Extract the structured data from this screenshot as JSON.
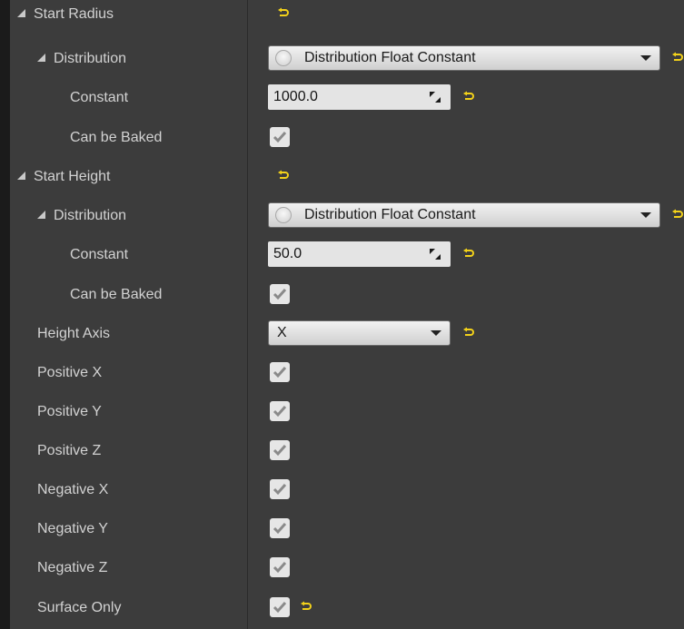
{
  "colors": {
    "panel_bg": "#3c3c3c",
    "reset_icon": "#f2d11a",
    "check_mark": "#8a8a8a"
  },
  "rows": {
    "start_radius": {
      "label": "Start Radius"
    },
    "start_radius_distribution": {
      "label": "Distribution",
      "value": "Distribution Float Constant"
    },
    "start_radius_constant": {
      "label": "Constant",
      "value": "1000.0"
    },
    "start_radius_can_be_baked": {
      "label": "Can be Baked",
      "checked": true
    },
    "start_height": {
      "label": "Start Height"
    },
    "start_height_distribution": {
      "label": "Distribution",
      "value": "Distribution Float Constant"
    },
    "start_height_constant": {
      "label": "Constant",
      "value": "50.0"
    },
    "start_height_can_be_baked": {
      "label": "Can be Baked",
      "checked": true
    },
    "height_axis": {
      "label": "Height Axis",
      "value": "X"
    },
    "positive_x": {
      "label": "Positive X",
      "checked": true
    },
    "positive_y": {
      "label": "Positive Y",
      "checked": true
    },
    "positive_z": {
      "label": "Positive Z",
      "checked": true
    },
    "negative_x": {
      "label": "Negative X",
      "checked": true
    },
    "negative_y": {
      "label": "Negative Y",
      "checked": true
    },
    "negative_z": {
      "label": "Negative Z",
      "checked": true
    },
    "surface_only": {
      "label": "Surface Only",
      "checked": true
    }
  },
  "icons": {
    "expand": "triangle-down-right-icon",
    "reset": "reset-to-default-icon",
    "drag": "drag-resize-icon",
    "check": "checkmark-icon",
    "dropdown": "caret-down-icon"
  }
}
